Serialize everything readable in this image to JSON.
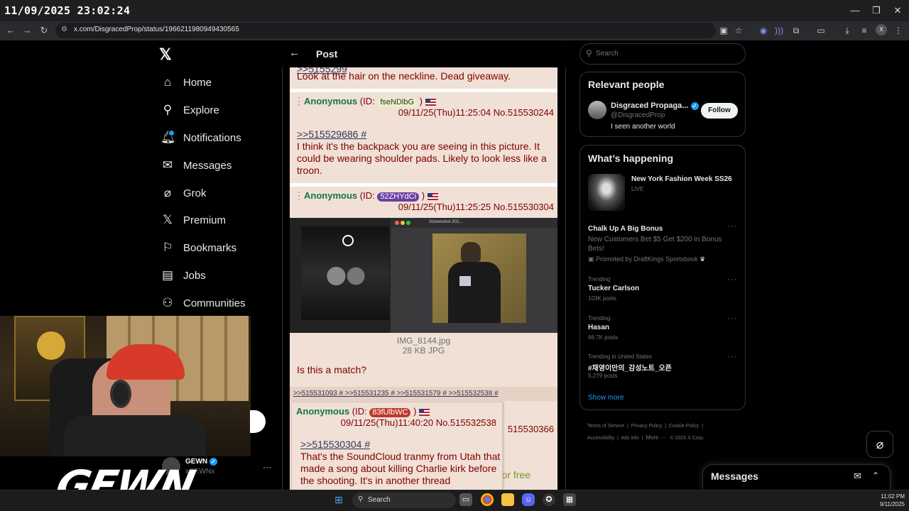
{
  "overlay": {
    "timestamp": "11/09/2025 23:02:24"
  },
  "browser": {
    "url": "x.com/DisgracedProp/status/1966211980949430565"
  },
  "nav": {
    "items": [
      {
        "label": "Home",
        "icon": "home-icon"
      },
      {
        "label": "Explore",
        "icon": "search-icon"
      },
      {
        "label": "Notifications",
        "icon": "bell-icon"
      },
      {
        "label": "Messages",
        "icon": "mail-icon"
      },
      {
        "label": "Grok",
        "icon": "grok-icon"
      },
      {
        "label": "Premium",
        "icon": "x-icon"
      },
      {
        "label": "Bookmarks",
        "icon": "bookmark-icon"
      },
      {
        "label": "Jobs",
        "icon": "briefcase-icon"
      },
      {
        "label": "Communities",
        "icon": "people-icon"
      }
    ]
  },
  "post": {
    "header": "Post",
    "chan": {
      "top_text": "Look at the hair on the neckline. Dead giveaway.",
      "reply1": {
        "name": "Anonymous",
        "id_prefix": "(ID:",
        "id": "fseNDlbG",
        "id_suffix": ")",
        "datetime": "09/11/25(Thu)11:25:04 No.515530244",
        "quote_link": ">>515529686 #",
        "text": "I think it's the backpack you are seeing in this picture. It could be wearing shoulder pads. Likely to look less like a troon."
      },
      "reply2": {
        "name": "Anonymous",
        "id_prefix": "(ID:",
        "id": "52ZHYdCi",
        "id_suffix": ")",
        "datetime": "09/11/25(Thu)11:25:25 No.515530304",
        "file_name": "IMG_8144.jpg",
        "file_meta": "28 KB JPG",
        "inner_window_title": "Screenshot 202...",
        "text": "Is this a match?",
        "backlinks": ">>515531093 # >>515531235 # >>515531579 # >>515532538 #"
      },
      "reply3": {
        "name": "Anonymous",
        "id_prefix": "(ID:",
        "id": "83fUlbWC",
        "id_suffix": ")",
        "datetime": "09/11/25(Thu)11:40:20 No.515532538",
        "quote_link": ">>515530304 #",
        "text": "That's the SoundCloud tranmy from Utah that made a song about killing Charlie kirk before the shooting. It's in another thread"
      },
      "behind_fragment_no": "515530366",
      "behind_fragment_text": "or free"
    }
  },
  "sidebar": {
    "search_placeholder": "Search",
    "relevant": {
      "title": "Relevant people",
      "name": "Disgraced Propaga...",
      "handle": "@DisgracedProp",
      "bio": "I seen another world",
      "follow_label": "Follow"
    },
    "happening": {
      "title": "What’s happening",
      "event_title": "New York Fashion Week SS26",
      "event_status": "LIVE",
      "promo_title": "Chalk Up A Big Bonus",
      "promo_text": "New Customers Bet $5 Get $200 in Bonus Bets!",
      "promo_by": "Promoted by DraftKings Sportsbook",
      "trends": [
        {
          "context": "Trending",
          "name": "Tucker Carlson",
          "count": "103K posts"
        },
        {
          "context": "Trending",
          "name": "Hasan",
          "count": "66.7K posts"
        },
        {
          "context": "Trending in United States",
          "name": "#채영이만의_감성노트_오픈",
          "count": "5,279 posts"
        }
      ],
      "show_more": "Show more"
    },
    "footer": {
      "links": [
        "Terms of Service",
        "Privacy Policy",
        "Cookie Policy",
        "Accessibility",
        "Ads info",
        "More ···"
      ],
      "copyright": "© 2025 X Corp."
    },
    "messages_label": "Messages"
  },
  "stream": {
    "username": "GEWN",
    "handle": "xGEWNx",
    "logo_text": "GEWN"
  },
  "taskbar": {
    "search_label": "Search",
    "time": "11:02 PM",
    "date": "9/11/2025"
  }
}
